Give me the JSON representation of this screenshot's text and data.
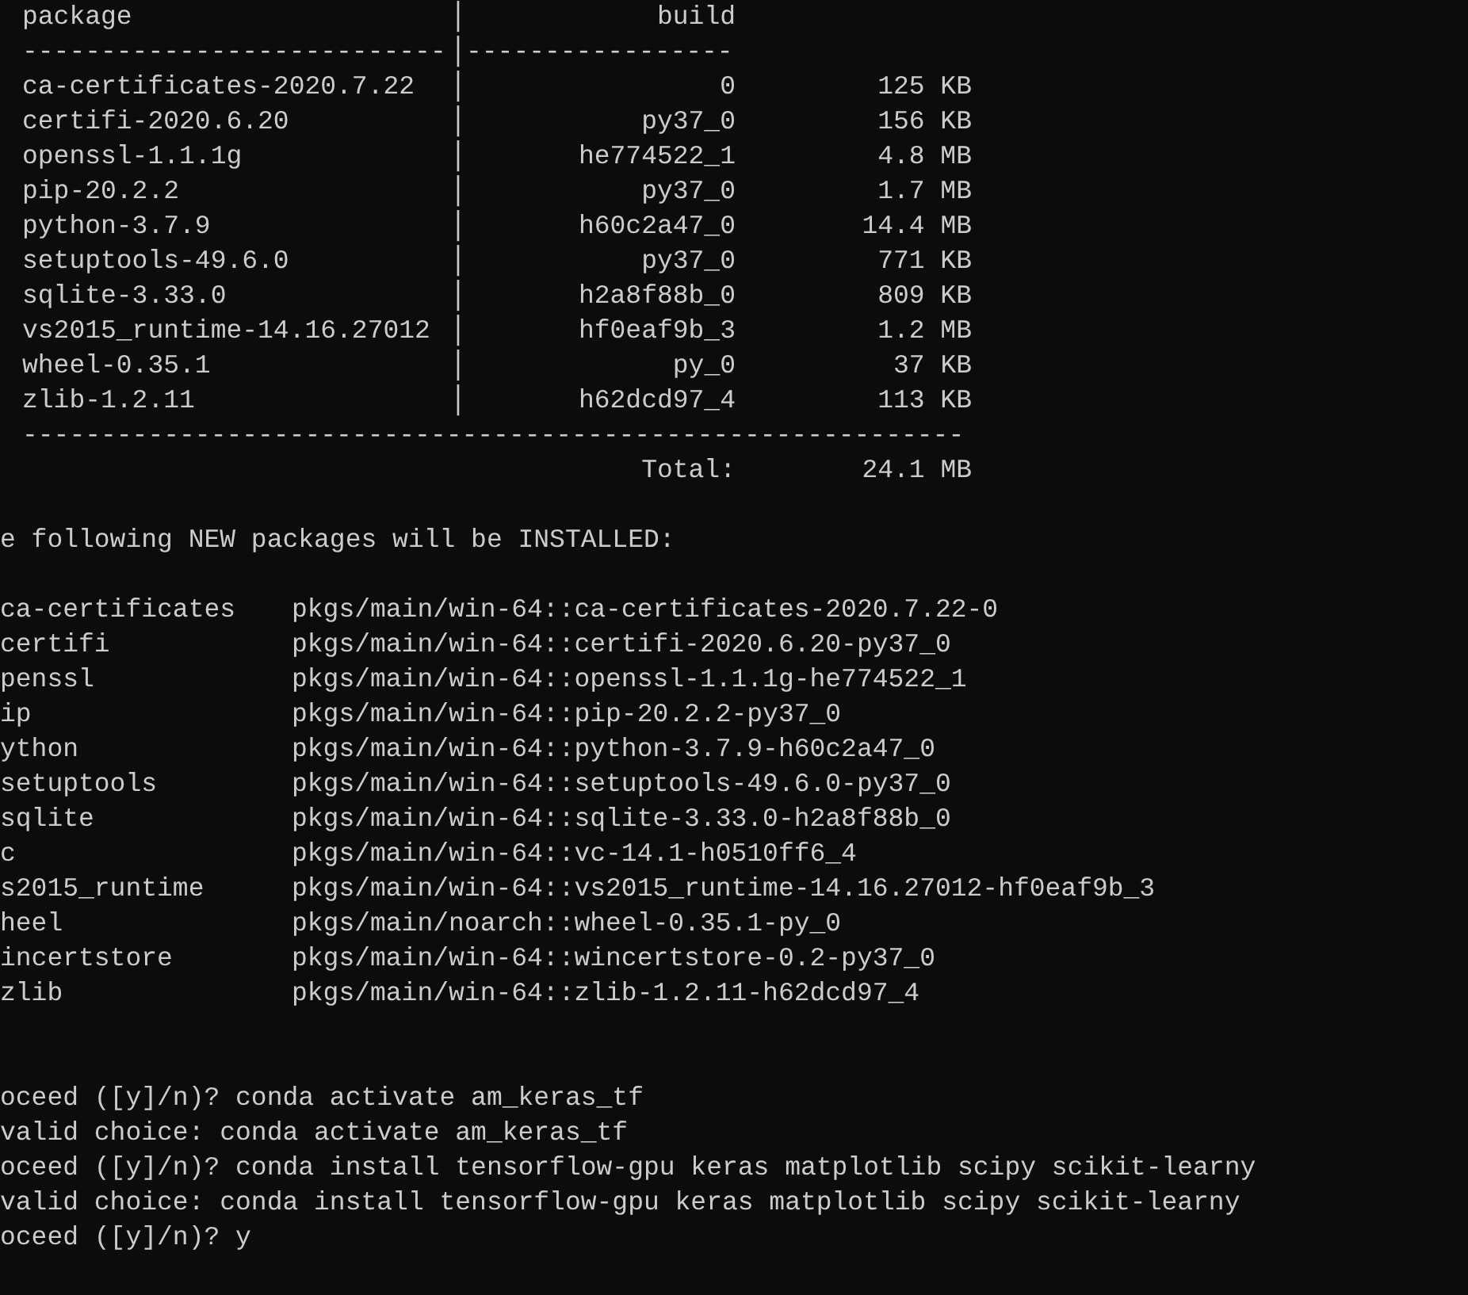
{
  "terminal": {
    "table": {
      "header": {
        "package": "package",
        "separator": "│",
        "build": "build"
      },
      "header_rule": {
        "left": "---------------------------",
        "separator": "│",
        "right": "-----------------"
      },
      "rows": [
        {
          "package": "ca-certificates-2020.7.22",
          "build": "0",
          "size": "125 KB"
        },
        {
          "package": "certifi-2020.6.20",
          "build": "py37_0",
          "size": "156 KB"
        },
        {
          "package": "openssl-1.1.1g",
          "build": "he774522_1",
          "size": "4.8 MB"
        },
        {
          "package": "pip-20.2.2",
          "build": "py37_0",
          "size": "1.7 MB"
        },
        {
          "package": "python-3.7.9",
          "build": "h60c2a47_0",
          "size": "14.4 MB"
        },
        {
          "package": "setuptools-49.6.0",
          "build": "py37_0",
          "size": "771 KB"
        },
        {
          "package": "sqlite-3.33.0",
          "build": "h2a8f88b_0",
          "size": "809 KB"
        },
        {
          "package": "vs2015_runtime-14.16.27012",
          "build": "hf0eaf9b_3",
          "size": "1.2 MB"
        },
        {
          "package": "wheel-0.35.1",
          "build": "py_0",
          "size": "37 KB"
        },
        {
          "package": "zlib-1.2.11",
          "build": "h62dcd97_4",
          "size": "113 KB"
        }
      ],
      "total_rule": "------------------------------------------------------------",
      "total_label": "Total:",
      "total": "24.1 MB"
    },
    "install_heading": "e following NEW packages will be INSTALLED:",
    "install_list": [
      {
        "name": "ca-certificates",
        "source": "pkgs/main/win-64::ca-certificates-2020.7.22-0"
      },
      {
        "name": "certifi",
        "source": "pkgs/main/win-64::certifi-2020.6.20-py37_0"
      },
      {
        "name": "penssl",
        "source": "pkgs/main/win-64::openssl-1.1.1g-he774522_1"
      },
      {
        "name": "ip",
        "source": "pkgs/main/win-64::pip-20.2.2-py37_0"
      },
      {
        "name": "ython",
        "source": "pkgs/main/win-64::python-3.7.9-h60c2a47_0"
      },
      {
        "name": "setuptools",
        "source": "pkgs/main/win-64::setuptools-49.6.0-py37_0"
      },
      {
        "name": "sqlite",
        "source": "pkgs/main/win-64::sqlite-3.33.0-h2a8f88b_0"
      },
      {
        "name": "c",
        "source": "pkgs/main/win-64::vc-14.1-h0510ff6_4"
      },
      {
        "name": "s2015_runtime",
        "source": "pkgs/main/win-64::vs2015_runtime-14.16.27012-hf0eaf9b_3"
      },
      {
        "name": "heel",
        "source": "pkgs/main/noarch::wheel-0.35.1-py_0"
      },
      {
        "name": "incertstore",
        "source": "pkgs/main/win-64::wincertstore-0.2-py37_0"
      },
      {
        "name": "zlib",
        "source": "pkgs/main/win-64::zlib-1.2.11-h62dcd97_4"
      }
    ],
    "log_lines": [
      "oceed ([y]/n)? conda activate am_keras_tf",
      "valid choice: conda activate am_keras_tf",
      "oceed ([y]/n)? conda install tensorflow-gpu keras matplotlib scipy scikit-learny",
      "valid choice: conda install tensorflow-gpu keras matplotlib scipy scikit-learny",
      "oceed ([y]/n)? y"
    ]
  }
}
